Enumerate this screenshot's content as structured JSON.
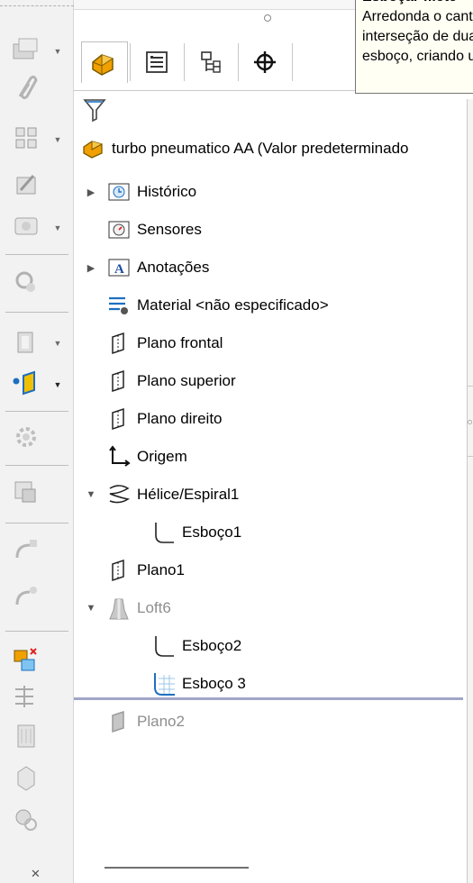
{
  "tooltip": {
    "title": "Esboçar filete",
    "lines": [
      "Arredonda o canto na",
      "interseção de duas",
      "esboço, criando um arco"
    ]
  },
  "tree": {
    "root": "turbo pneumatico AA  (Valor predeterminado",
    "items": [
      {
        "label": "Histórico"
      },
      {
        "label": "Sensores"
      },
      {
        "label": "Anotações"
      },
      {
        "label": "Material <não especificado>"
      },
      {
        "label": "Plano frontal"
      },
      {
        "label": "Plano superior"
      },
      {
        "label": "Plano direito"
      },
      {
        "label": "Origem"
      },
      {
        "label": "Hélice/Espiral1"
      },
      {
        "label": "Esboço1"
      },
      {
        "label": "Plano1"
      },
      {
        "label": "Loft6"
      },
      {
        "label": "Esboço2"
      },
      {
        "label": "Esboço 3"
      },
      {
        "label": "Plano2"
      }
    ]
  },
  "colors": {
    "accent_orange": "#f0a000",
    "accent_blue": "#1e6fc0",
    "rollback_bar": "#9fa6c8",
    "tooltip_bg": "#fffff4"
  },
  "icons": {
    "tabs": [
      "feature-manager-icon",
      "property-manager-icon",
      "configuration-manager-icon",
      "dimxpert-icon"
    ],
    "filter": "filter-icon"
  }
}
